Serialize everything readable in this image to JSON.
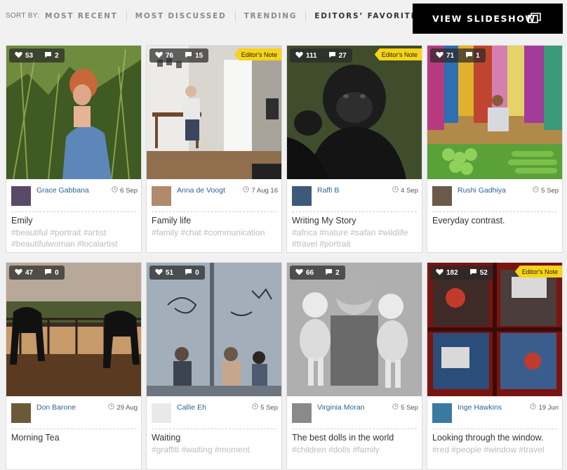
{
  "sort": {
    "label": "SORT BY:",
    "tabs": [
      "MOST RECENT",
      "MOST DISCUSSED",
      "TRENDING",
      "EDITORS’ FAVORITES"
    ],
    "active": "EDITORS’ FAVORITES"
  },
  "slideshow": {
    "label": "VIEW SLIDESHOW"
  },
  "cards": [
    {
      "likes": "53",
      "comments": "2",
      "editors_note": "",
      "author": "Grace Gabbana",
      "date": "6 Sep",
      "title": "Emily",
      "tags": "#beautiful #portrait #artist #beautifulwoman #localartist"
    },
    {
      "likes": "76",
      "comments": "15",
      "editors_note": "Editor's Note",
      "author": "Anna de Voogt",
      "date": "7 Aug 16",
      "title": "Family life",
      "tags": "#family #chat #communication"
    },
    {
      "likes": "111",
      "comments": "27",
      "editors_note": "Editor's Note",
      "author": "Raffi B",
      "date": "4 Sep",
      "title": "Writing My Story",
      "tags": "#africa #nature #safari #wildlife #travel #portrait"
    },
    {
      "likes": "71",
      "comments": "1",
      "editors_note": "",
      "author": "Rushi Gadhiya",
      "date": "5 Sep",
      "title": "Everyday contrast.",
      "tags": ""
    },
    {
      "likes": "47",
      "comments": "0",
      "editors_note": "",
      "author": "Don Barone",
      "date": "29 Aug",
      "title": "Morning Tea",
      "tags": ""
    },
    {
      "likes": "51",
      "comments": "0",
      "editors_note": "",
      "author": "Callie Eh",
      "date": "5 Sep",
      "title": "Waiting",
      "tags": "#graffiti #waiting #moment"
    },
    {
      "likes": "66",
      "comments": "2",
      "editors_note": "",
      "author": "Virginia Moran",
      "date": "5 Sep",
      "title": "The best dolls in the world",
      "tags": "#children #dolls #family"
    },
    {
      "likes": "182",
      "comments": "52",
      "editors_note": "Editor's Note",
      "author": "Inge Hawkins",
      "date": "19 Jun",
      "title": "Looking through the window.",
      "tags": "#red #people #window #travel"
    }
  ],
  "icons": {
    "like": "heart-icon",
    "comment": "speech-bubble-icon",
    "date": "clock-icon",
    "slideshow": "slideshow-icon"
  },
  "colors": {
    "author_link": "#2a6496",
    "editors_note": "#f7d417",
    "tag_text": "#bcbcbc"
  }
}
